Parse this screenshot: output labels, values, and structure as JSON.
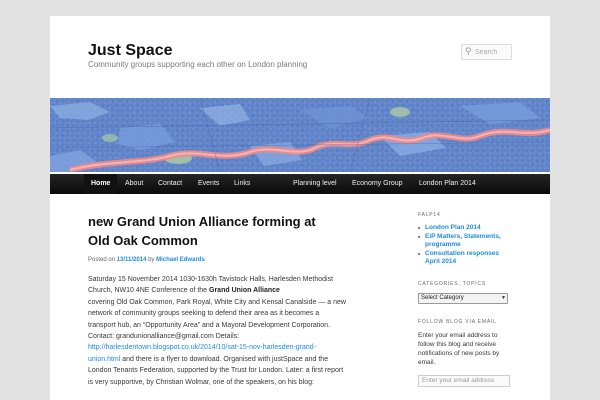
{
  "site": {
    "title": "Just Space",
    "description": "Community groups supporting each other on London planning"
  },
  "search": {
    "placeholder": "Search",
    "icon": "magnifier-icon"
  },
  "nav": {
    "items": [
      "Home",
      "About",
      "Contact",
      "Events",
      "Links",
      "Planning level",
      "Economy Group",
      "London Plan 2014"
    ],
    "active": "Home"
  },
  "post": {
    "title_line1": "new Grand Union Alliance forming at",
    "title_line2": "Old Oak Common",
    "meta_posted_on": "Posted on",
    "meta_date": "13/11/2014",
    "meta_by": "by",
    "meta_author": "Michael Edwards",
    "p1": "Saturday 15 November 2014 1030-1630h Tavistock Halls, Harlesden Methodist Church, NW10 4NE Conference of the",
    "p1_bold": "Grand Union Alliance",
    "p2": "covering Old Oak Common, Park Royal, White City and Kensal Canalside — a new network of community groups seeking to defend their area as it becomes a transport hub, an “Opportunity Area” and a Mayoral Development Corporation. Contact: grandunionalliance@gmail.com Details:",
    "link": "http://harlesdentown.blogspot.co.uk/2014/10/sat-15-nov-harlesden-grand-union.html",
    "p3": "and there is a flyer to download. Organised with justSpace and the London Tenants Federation, supported by the Trust for London. Later:  a first report is very supportive, by Christian Wolmar, one of the speakers, on his blog:"
  },
  "sidebar": {
    "falp_title": "FALP14",
    "falp_links": [
      "London Plan 2014",
      "EiP Matters, Statements, programme",
      "Consultation responses April 2014"
    ],
    "categories_title": "Categories, Topics",
    "categories_select": "Select Category",
    "follow_title": "Follow Blog via Email",
    "follow_text": "Enter your email address to follow this blog and receive notifications of new posts by email.",
    "email_placeholder": "Enter your email address"
  },
  "colors": {
    "link": "#1b8be0",
    "nav_bg": "#111111",
    "map_base": "#5b7fc6",
    "map_river": "#f08a8a"
  }
}
